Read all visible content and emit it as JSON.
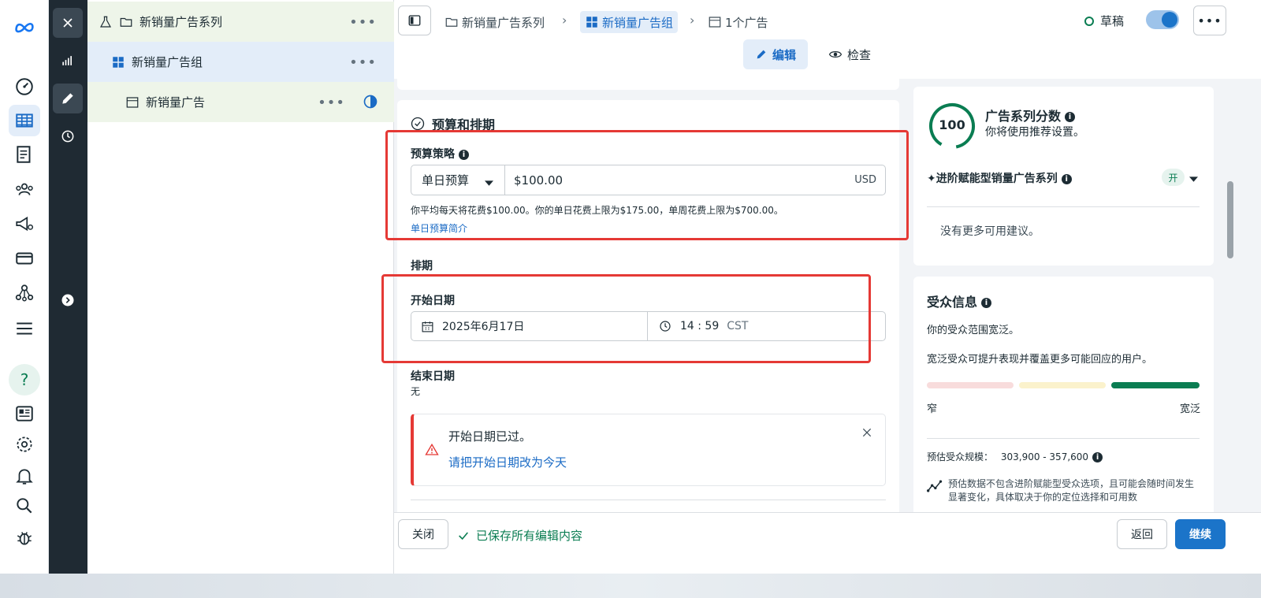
{
  "tree": {
    "campaign_label": "新销量广告系列",
    "adset_label": "新销量广告组",
    "ad_label": "新销量广告",
    "more": "•••"
  },
  "header": {
    "crumb_campaign": "新销量广告系列",
    "crumb_adset": "新销量广告组",
    "crumb_ad": "1个广告",
    "status_label": "草稿",
    "edit_tab": "编辑",
    "review_tab": "检查"
  },
  "budget": {
    "section_title": "预算和排期",
    "strategy_label": "预算策略",
    "type_value": "单日预算",
    "amount_value": "$100.00",
    "currency": "USD",
    "hint": "你平均每天将花费$100.00。你的单日花费上限为$175.00，单周花费上限为$700.00。",
    "link": "单日预算简介"
  },
  "schedule": {
    "title": "排期",
    "start_label": "开始日期",
    "start_date": "2025年6月17日",
    "start_time": "14 : 59",
    "timezone": "CST",
    "end_label": "结束日期",
    "end_value": "无"
  },
  "alert": {
    "message": "开始日期已过。",
    "action": "请把开始日期改为今天"
  },
  "score": {
    "value": "100",
    "title": "广告系列分数",
    "subtitle": "你将使用推荐设置。",
    "advantage_label": "✦进阶赋能型销量广告系列",
    "advantage_status": "开",
    "no_more": "没有更多可用建议。"
  },
  "audience": {
    "title": "受众信息",
    "line1": "你的受众范围宽泛。",
    "line2": "宽泛受众可提升表现并覆盖更多可能回应的用户。",
    "narrow": "窄",
    "broad": "宽泛",
    "size_label": "预估受众规模：",
    "size_value": "303,900 - 357,600",
    "note": "预估数据不包含进阶赋能型受众选项，且可能会随时间发生显著变化，具体取决于你的定位选择和可用数"
  },
  "footer": {
    "close": "关闭",
    "saved": "已保存所有编辑内容",
    "back": "返回",
    "continue": "继续"
  },
  "colors": {
    "accent": "#1b74c9",
    "score_ring": "#0a7d52",
    "alert_red": "#e53935"
  },
  "icons": [
    "meta-logo-icon",
    "dashboard-icon",
    "table-icon",
    "catalog-icon",
    "audience-icon",
    "megaphone-icon",
    "billing-icon",
    "network-icon",
    "menu-icon",
    "help-icon",
    "news-icon",
    "settings-icon",
    "bell-icon",
    "search-icon",
    "bug-icon"
  ]
}
